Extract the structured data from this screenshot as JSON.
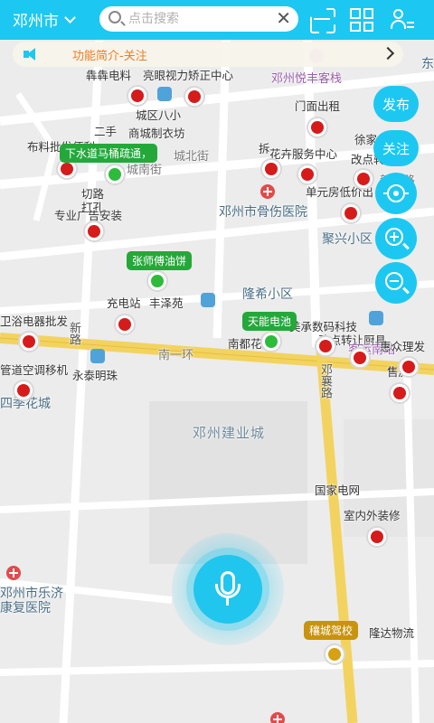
{
  "header": {
    "city": "邓州市",
    "search_placeholder": "点击搜索",
    "clear_glyph": "✕",
    "icons": [
      "chevron-down-icon",
      "search-icon",
      "close-icon",
      "scan-icon",
      "grid-icon",
      "user-list-icon"
    ]
  },
  "notice": {
    "text": "功能简介-关注",
    "icons": [
      "speaker-icon",
      "chevron-right-icon"
    ]
  },
  "buttons": {
    "publish": "发布",
    "follow": "关注",
    "icons": [
      "locate-icon",
      "zoom-in-icon",
      "zoom-out-icon",
      "microphone-icon"
    ]
  },
  "map": {
    "labels": {
      "hotel": "邓州悦丰客栈",
      "east": "东",
      "electric": "犇犇电料",
      "vision": "亮眼视力矫正中心",
      "chengqu": "城区八小",
      "secondhand": "二手",
      "clothing": "商城制衣坊",
      "cheng_bei": "城北街",
      "nan_street": "城南街",
      "materials": "布料批发便利",
      "plumbing": "下水道马桶疏通，",
      "cutroad": "切路",
      "punch": "打孔",
      "ads": "专业广告安装",
      "shop_rent": "门面出租",
      "xujia": "徐家",
      "flower": "花卉服务中心",
      "demolish": "拆",
      "install": "改点转",
      "newroad": "新华路",
      "house": "单元房低价出",
      "hospital": "邓州市骨伤医院",
      "juxing": "聚兴小区",
      "zhangshi": "张师傅油饼",
      "charging": "充电站",
      "fengze": "丰泽苑",
      "longxi": "隆希小区",
      "bathroom": "卫浴电器批发",
      "tianneng": "天能电池",
      "meicheng": "美承数码科技",
      "nandu": "南都花园",
      "ring": "南一环",
      "refit": "改点转让厨具",
      "station": "客运南站",
      "huizhong": "惠众理发",
      "pipe": "管道空调移机",
      "yongtai": "永泰明珠",
      "seasons": "四季花城",
      "sale": "售房",
      "dengxiang": "邓襄路",
      "jianye": "邓州建业城",
      "telecom": "国家电网",
      "decor": "室内外装修",
      "rehab1": "邓州市乐济",
      "rehab2": "康复医院",
      "driving": "穰城驾校",
      "longda": "隆达物流",
      "xinlu": "新路"
    },
    "tags": {
      "plumbing_tag": "下水道马桶疏通，",
      "zhangshi_tag": "张师傅油饼",
      "tianneng_tag": "天能电池",
      "driving_tag": "穰城驾校"
    },
    "colors": {
      "accent": "#1cc8f1",
      "red_marker": "#d61b1b",
      "green_marker": "#2dbb3c",
      "gold_marker": "#d6a112",
      "road_yellow": "#f3d35f"
    }
  }
}
